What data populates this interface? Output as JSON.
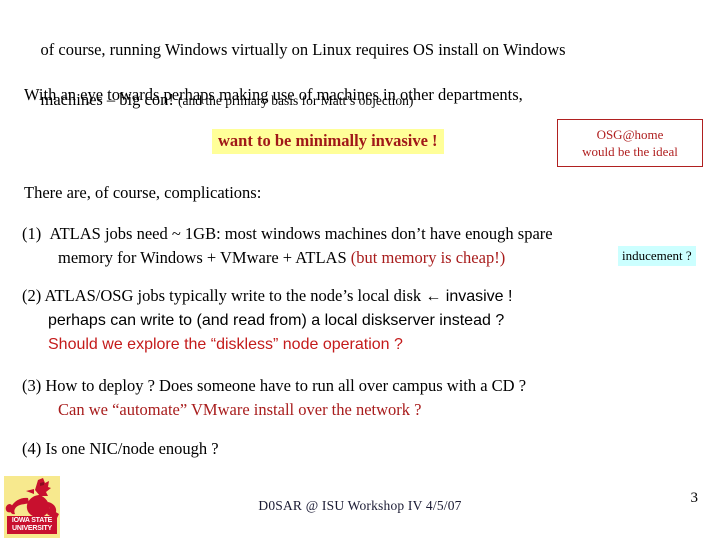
{
  "slide": {
    "page_number": "3",
    "footer": "D0SAR @ ISU Workshop IV   4/5/07",
    "background_color": "#ffffff"
  },
  "intro": {
    "line1": "of course, running Windows virtually on Linux requires OS install on Windows",
    "line2_main": "machines – big con! ",
    "line2_note": "(and the primary basis for Matt’s objection)"
  },
  "eye_paragraph": {
    "text": "With an eye towards perhaps making use of machines in other departments,"
  },
  "callout": {
    "text": "want to be minimally invasive !",
    "background_color": "#ffff99",
    "text_color": "#a01818"
  },
  "osg_box": {
    "line1": "OSG@home",
    "line2": "would be the ideal",
    "border_color": "#b02020",
    "text_color": "#b02020"
  },
  "complications": {
    "lead": "There are, of course, complications:",
    "items": [
      {
        "marker": "(1)",
        "line1": "ATLAS jobs need ~ 1GB:  most windows machines don’t have enough spare",
        "line2_main": "memory for Windows + VMware + ATLAS  ",
        "line2_red": "(but memory is cheap!)",
        "chip": "inducement ?",
        "chip_background": "#ccffff",
        "red_color": "#a81c1c"
      },
      {
        "marker": "(2)",
        "line1_serif": "ATLAS/OSG jobs typically write to the node’s local disk ",
        "line1_sans": "← invasive !",
        "line2": "perhaps can write to (and read from) a local diskserver instead ?",
        "line3": "Should we explore the “diskless” node operation ?",
        "line3_color": "#c41b1b"
      },
      {
        "marker": "(3)",
        "line1": "How to deploy ? Does someone have to run all over campus with a CD ?",
        "line2_red": "Can we “automate” VMware install over the network ?",
        "red_color": "#a81c1c"
      },
      {
        "marker": "(4)",
        "line1": "Is one NIC/node enough ?"
      }
    ]
  },
  "logo": {
    "name": "iowa-state-university-logo",
    "wordmark_line1": "IOWA STATE",
    "wordmark_line2": "UNIVERSITY",
    "background_color": "#f7e98e",
    "mascot_color": "#c8102e"
  }
}
